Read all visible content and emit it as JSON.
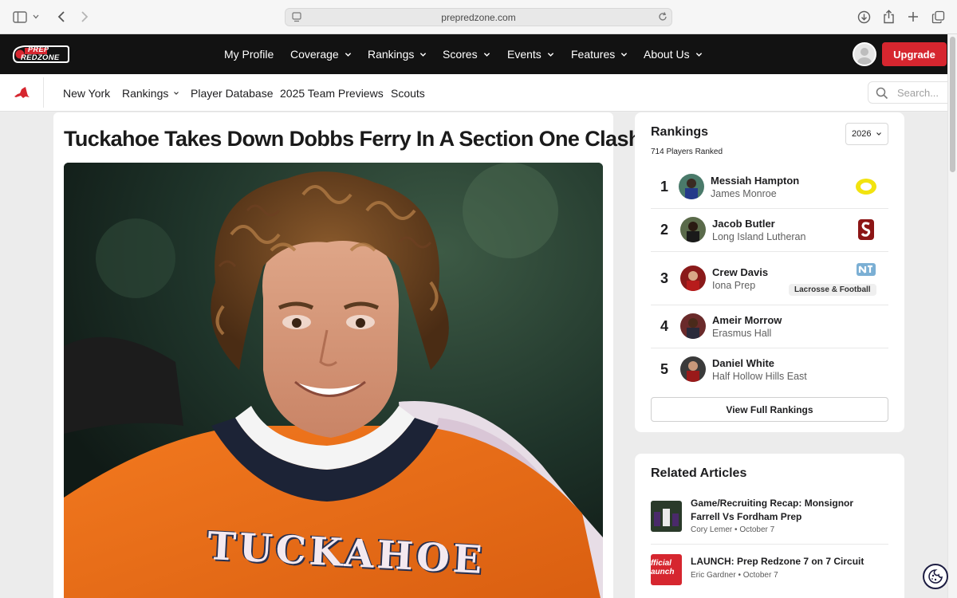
{
  "browser": {
    "url": "prepredzone.com",
    "icons": [
      "sidebar-icon",
      "chevron-down-icon",
      "back-icon",
      "forward-icon",
      "download-icon",
      "share-icon",
      "new-tab-icon",
      "tabs-overview-icon"
    ]
  },
  "site": {
    "logo": {
      "line1": "PREP",
      "line2": "REDZONE"
    },
    "nav": [
      {
        "label": "My Profile",
        "dropdown": false
      },
      {
        "label": "Coverage",
        "dropdown": true
      },
      {
        "label": "Rankings",
        "dropdown": true
      },
      {
        "label": "Scores",
        "dropdown": true
      },
      {
        "label": "Events",
        "dropdown": true
      },
      {
        "label": "Features",
        "dropdown": true
      },
      {
        "label": "About Us",
        "dropdown": true
      }
    ],
    "upgrade_label": "Upgrade",
    "brand_color": "#d6262f"
  },
  "subnav": {
    "items": [
      {
        "label": "New York",
        "dropdown": false
      },
      {
        "label": "Rankings",
        "dropdown": true
      },
      {
        "label": "Player Database",
        "dropdown": false
      },
      {
        "label": "2025 Team Previews",
        "dropdown": false
      },
      {
        "label": "Scouts",
        "dropdown": false
      }
    ],
    "search_placeholder": "Search..."
  },
  "article": {
    "title": "Tuckahoe Takes Down Dobbs Ferry In A Section One Clash",
    "jersey_text": "TUCKAHOE"
  },
  "rankings": {
    "title": "Rankings",
    "year": "2026",
    "count_text": "714 Players Ranked",
    "players": [
      {
        "rank": "1",
        "name": "Messiah Hampton",
        "school": "James Monroe",
        "college": "oregon-logo"
      },
      {
        "rank": "2",
        "name": "Jacob Butler",
        "school": "Long Island Lutheran",
        "college": "stanford-logo"
      },
      {
        "rank": "3",
        "name": "Crew Davis",
        "school": "Iona Prep",
        "college": "unc-logo",
        "badge": "Lacrosse & Football"
      },
      {
        "rank": "4",
        "name": "Ameir Morrow",
        "school": "Erasmus Hall"
      },
      {
        "rank": "5",
        "name": "Daniel White",
        "school": "Half Hollow Hills East"
      }
    ],
    "view_full_label": "View Full Rankings"
  },
  "related": {
    "title": "Related Articles",
    "items": [
      {
        "title": "Game/Recruiting Recap: Monsignor Farrell Vs Fordham Prep",
        "author": "Cory Lemer",
        "date": "October 7"
      },
      {
        "title": "LAUNCH: Prep Redzone 7 on 7 Circuit",
        "author": "Eric Gardner",
        "date": "October 7",
        "thumb_text": "fficial\naunch"
      }
    ]
  }
}
